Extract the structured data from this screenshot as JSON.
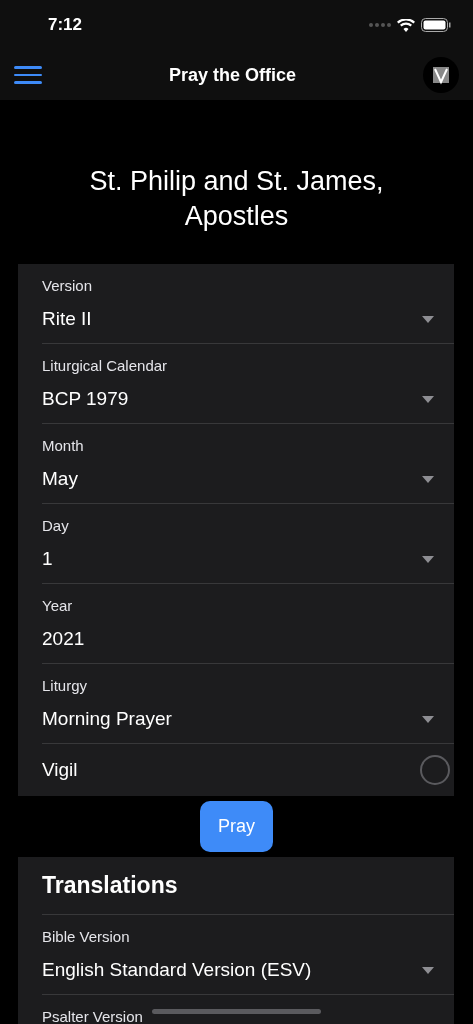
{
  "status_bar": {
    "time": "7:12"
  },
  "nav": {
    "title": "Pray the Office"
  },
  "heading": "St. Philip and St. James, Apostles",
  "form": [
    {
      "kind": "select",
      "label": "Version",
      "value": "Rite II"
    },
    {
      "kind": "select",
      "label": "Liturgical Calendar",
      "value": "BCP 1979"
    },
    {
      "kind": "select",
      "label": "Month",
      "value": "May"
    },
    {
      "kind": "select",
      "label": "Day",
      "value": "1"
    },
    {
      "kind": "text",
      "label": "Year",
      "value": "2021"
    },
    {
      "kind": "select",
      "label": "Liturgy",
      "value": "Morning Prayer"
    },
    {
      "kind": "toggle",
      "label": "Vigil",
      "on": false
    }
  ],
  "pray_button": "Pray",
  "translations": {
    "title": "Translations",
    "fields": [
      {
        "kind": "select",
        "label": "Bible Version",
        "value": "English Standard Version (ESV)"
      },
      {
        "kind": "select",
        "label": "Psalter Version"
      }
    ]
  }
}
